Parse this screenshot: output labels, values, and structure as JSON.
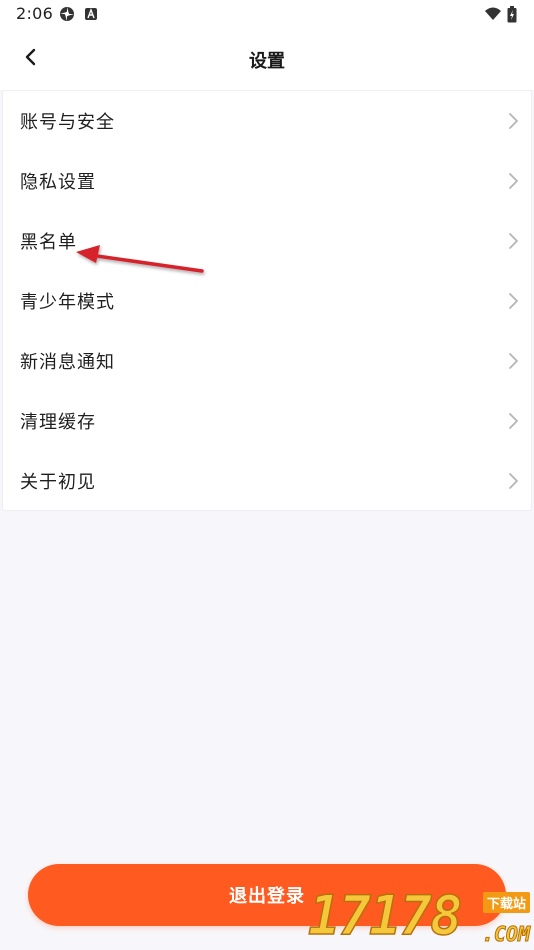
{
  "status_bar": {
    "time": "2:06",
    "icons": [
      "app-notification-icon",
      "a-letter-icon",
      "wifi-icon",
      "battery-icon"
    ]
  },
  "header": {
    "title": "设置",
    "back_icon": "chevron-left-icon"
  },
  "settings": {
    "items": [
      {
        "label": "账号与安全"
      },
      {
        "label": "隐私设置"
      },
      {
        "label": "黑名单"
      },
      {
        "label": "青少年模式"
      },
      {
        "label": "新消息通知"
      },
      {
        "label": "清理缓存"
      },
      {
        "label": "关于初见"
      }
    ]
  },
  "logout": {
    "label": "退出登录"
  },
  "watermark": {
    "digits": "17178",
    "site": "下载站",
    "com": ".COM"
  },
  "colors": {
    "accent": "#ff5a1f",
    "background": "#f7f7fb",
    "annotation_arrow": "#d6202a"
  }
}
